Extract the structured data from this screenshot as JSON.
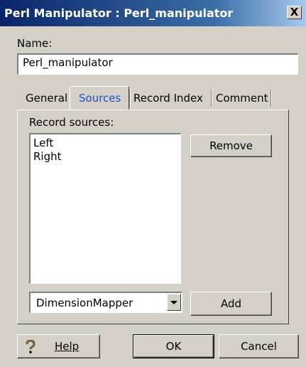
{
  "window": {
    "title": "Perl Manipulator :  Perl_manipulator",
    "close_glyph": "X"
  },
  "name_field": {
    "label": "Name:",
    "value": "Perl_manipulator"
  },
  "tabs": [
    {
      "label": "General",
      "active": false
    },
    {
      "label": "Sources",
      "active": true
    },
    {
      "label": "Record Index",
      "active": false
    },
    {
      "label": "Comment",
      "active": false
    }
  ],
  "sources": {
    "label": "Record sources:",
    "items": [
      "Left",
      "Right"
    ],
    "remove_label": "Remove",
    "combo_value": "DimensionMapper",
    "add_label": "Add"
  },
  "footer": {
    "help_label": "Help",
    "help_icon": "question-mark-icon",
    "ok_label": "OK",
    "cancel_label": "Cancel"
  },
  "colors": {
    "title_gradient_start": "#0a246a",
    "title_gradient_end": "#a6caf0",
    "active_tab_text": "#1f4fd0",
    "dialog_bg": "#d4d0c8"
  }
}
